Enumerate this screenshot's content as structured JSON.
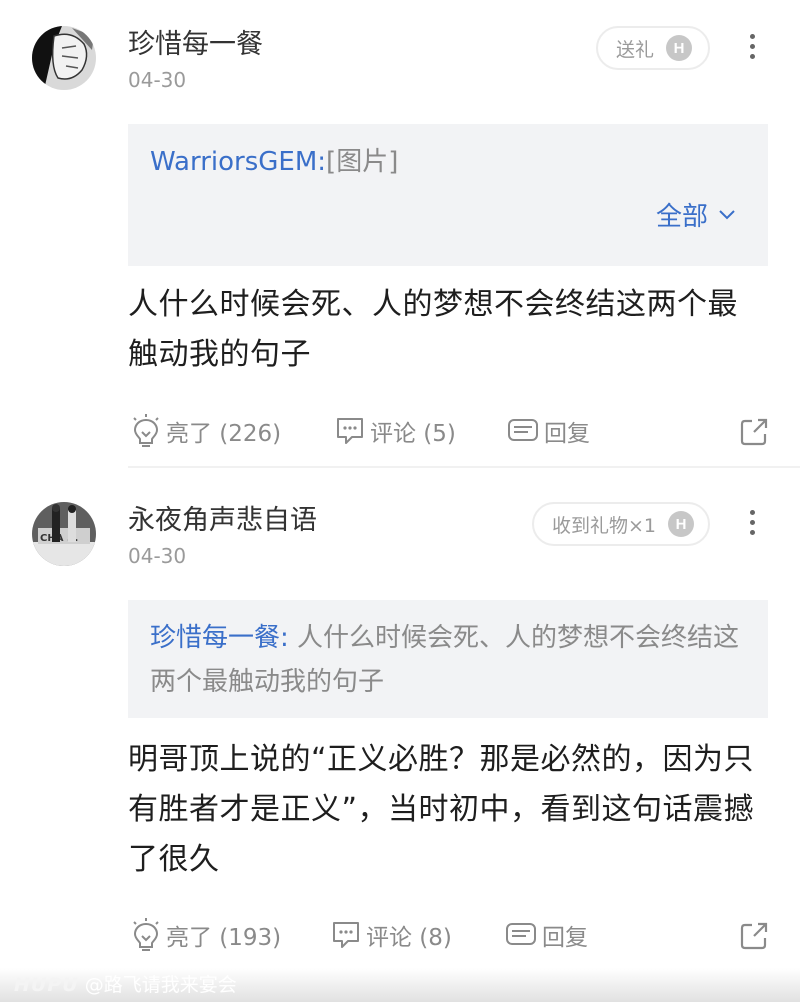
{
  "comments": [
    {
      "username": "珍惜每一餐",
      "date": "04-30",
      "gift_label": "送礼",
      "badge": "H",
      "quote": {
        "author": "WarriorsGEM:",
        "text": "[图片]",
        "expand_label": "全部"
      },
      "body": "人什么时候会死、人的梦想不会终结这两个最触动我的句子",
      "like_label": "亮了 (226)",
      "comment_label": "评论 (5)",
      "reply_label": "回复"
    },
    {
      "username": "永夜角声悲自语",
      "date": "04-30",
      "gift_label": "收到礼物×1",
      "badge": "H",
      "quote": {
        "author": "珍惜每一餐:",
        "text": " 人什么时候会死、人的梦想不会终结这两个最触动我的句子"
      },
      "body": "明哥顶上说的“正义必胜？那是必然的，因为只有胜者才是正义”，当时初中，看到这句话震撼了很久",
      "like_label": "亮了 (193)",
      "comment_label": "评论 (8)",
      "reply_label": "回复"
    }
  ],
  "footer": {
    "brand": "HUPU",
    "handle": "@路飞请我来宴会"
  },
  "colors": {
    "link_blue": "#3a6fc9",
    "quote_bg": "#f2f3f5",
    "muted": "#8a8a8a"
  }
}
